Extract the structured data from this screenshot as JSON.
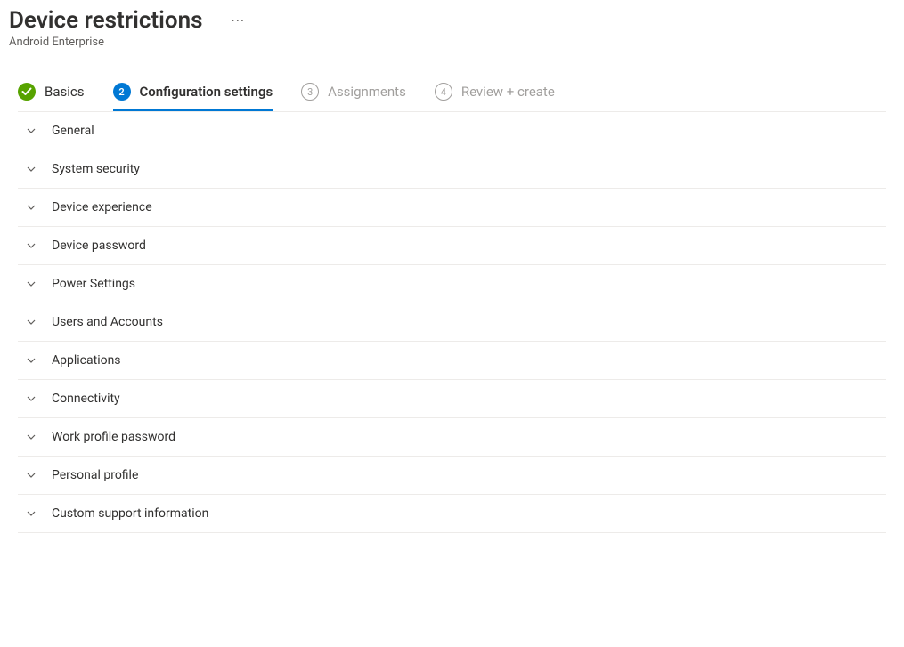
{
  "header": {
    "title": "Device restrictions",
    "subtitle": "Android Enterprise",
    "more_dots": "···"
  },
  "tabs": [
    {
      "label": "Basics",
      "state": "completed",
      "number": ""
    },
    {
      "label": "Configuration settings",
      "state": "current",
      "number": "2"
    },
    {
      "label": "Assignments",
      "state": "upcoming",
      "number": "3"
    },
    {
      "label": "Review + create",
      "state": "upcoming",
      "number": "4"
    }
  ],
  "accordion": {
    "items": [
      {
        "label": "General"
      },
      {
        "label": "System security"
      },
      {
        "label": "Device experience"
      },
      {
        "label": "Device password"
      },
      {
        "label": "Power Settings"
      },
      {
        "label": "Users and Accounts"
      },
      {
        "label": "Applications"
      },
      {
        "label": "Connectivity"
      },
      {
        "label": "Work profile password"
      },
      {
        "label": "Personal profile"
      },
      {
        "label": "Custom support information"
      }
    ]
  }
}
